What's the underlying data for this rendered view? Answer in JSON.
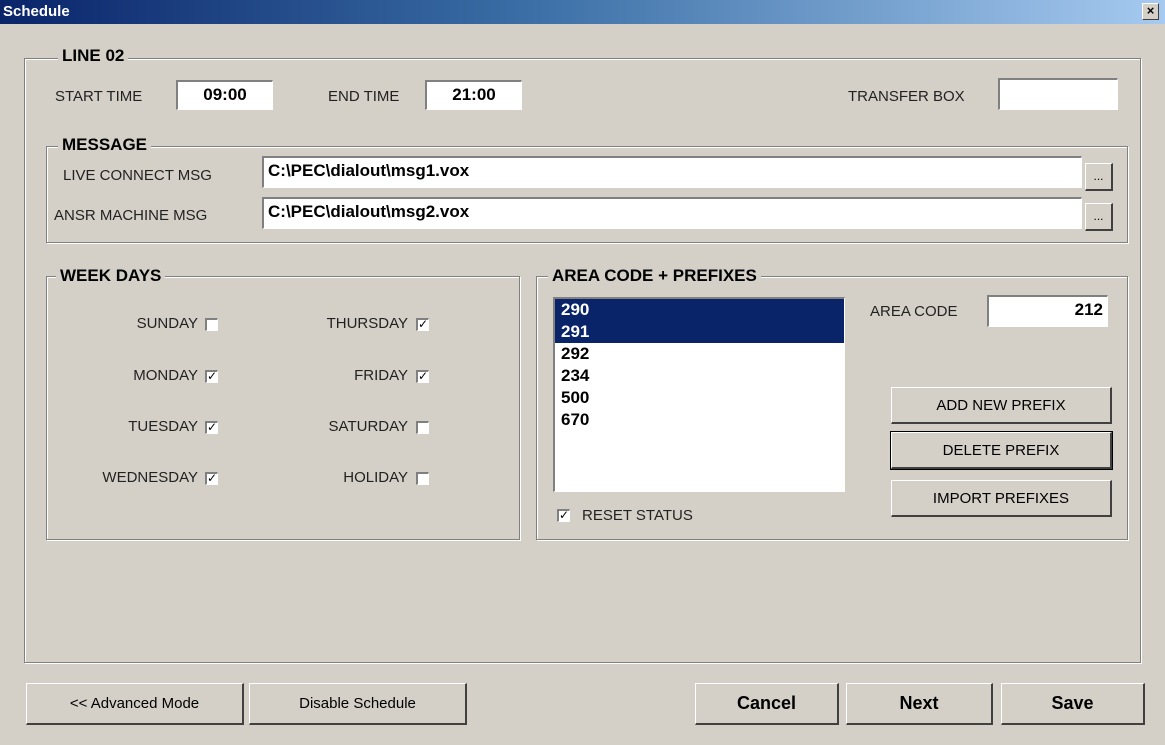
{
  "window": {
    "title": "Schedule",
    "close_glyph": "×"
  },
  "line": {
    "legend": "LINE 02",
    "start_time_label": "START TIME",
    "start_time_value": "09:00",
    "end_time_label": "END TIME",
    "end_time_value": "21:00",
    "transfer_box_label": "TRANSFER BOX",
    "transfer_box_value": ""
  },
  "message": {
    "legend": "MESSAGE",
    "live_label": "LIVE CONNECT MSG",
    "live_value": "C:\\PEC\\dialout\\msg1.vox",
    "ansr_label": "ANSR MACHINE MSG",
    "ansr_value": "C:\\PEC\\dialout\\msg2.vox",
    "browse_label": "..."
  },
  "week_days": {
    "legend": "WEEK DAYS",
    "days": [
      {
        "label": "SUNDAY",
        "checked": false
      },
      {
        "label": "MONDAY",
        "checked": true
      },
      {
        "label": "TUESDAY",
        "checked": true
      },
      {
        "label": "WEDNESDAY",
        "checked": true
      },
      {
        "label": "THURSDAY",
        "checked": true
      },
      {
        "label": "FRIDAY",
        "checked": true
      },
      {
        "label": "SATURDAY",
        "checked": false
      },
      {
        "label": "HOLIDAY",
        "checked": false
      }
    ]
  },
  "area": {
    "legend": "AREA CODE + PREFIXES",
    "prefixes": [
      {
        "value": "290",
        "selected": true
      },
      {
        "value": "291",
        "selected": true
      },
      {
        "value": "292",
        "selected": false
      },
      {
        "value": "234",
        "selected": false
      },
      {
        "value": "500",
        "selected": false
      },
      {
        "value": "670",
        "selected": false
      }
    ],
    "area_code_label": "AREA CODE",
    "area_code_value": "212",
    "add_label": "ADD NEW PREFIX",
    "delete_label": "DELETE PREFIX",
    "import_label": "IMPORT PREFIXES",
    "reset_label": "RESET STATUS",
    "reset_checked": true
  },
  "footer": {
    "advanced_label": "<< Advanced Mode",
    "disable_label": "Disable Schedule",
    "cancel_label": "Cancel",
    "next_label": "Next",
    "save_label": "Save"
  },
  "colors": {
    "selection": "#0a246a",
    "face": "#d4d0c8",
    "title_start": "#0a246a"
  },
  "icons": {
    "check": "check-icon",
    "close": "close-icon"
  }
}
